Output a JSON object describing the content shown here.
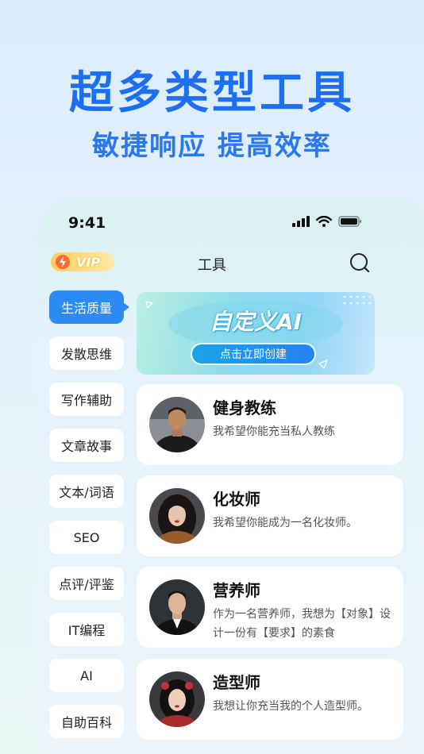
{
  "hero": {
    "title": "超多类型工具",
    "subtitle": "敏捷响应 提高效率"
  },
  "status": {
    "time": "9:41"
  },
  "nav": {
    "vip": "VIP",
    "title": "工具"
  },
  "sidebar": {
    "items": [
      {
        "label": "生活质量",
        "active": true
      },
      {
        "label": "发散思维"
      },
      {
        "label": "写作辅助"
      },
      {
        "label": "文章故事"
      },
      {
        "label": "文本/词语"
      },
      {
        "label": "SEO"
      },
      {
        "label": "点评/评鉴"
      },
      {
        "label": "IT编程"
      },
      {
        "label": "AI"
      },
      {
        "label": "自助百科"
      }
    ]
  },
  "banner": {
    "title": "自定义AI",
    "button": "点击立即创建"
  },
  "cards": [
    {
      "name": "健身教练",
      "desc": "我希望你能充当私人教练"
    },
    {
      "name": "化妆师",
      "desc": "我希望你能成为一名化妆师。"
    },
    {
      "name": "营养师",
      "desc": "作为一名营养师，我想为【对象】设计一份有【要求】的素食"
    },
    {
      "name": "造型师",
      "desc": "我想让你充当我的个人造型师。"
    }
  ],
  "colors": {
    "accent": "#1d6ff2",
    "active_tab": "#2b8bf2"
  }
}
